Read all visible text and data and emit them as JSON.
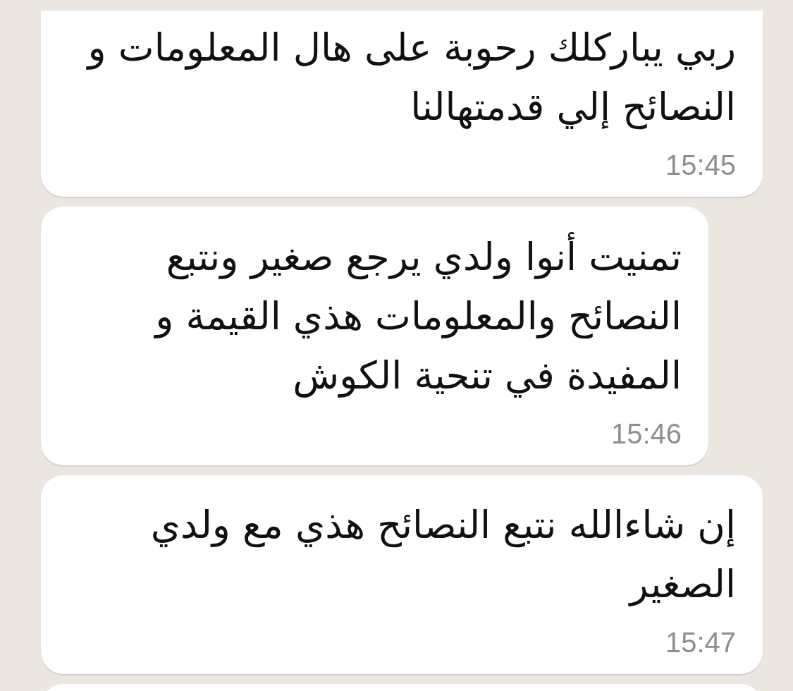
{
  "messages": [
    {
      "text": "ربي يباركلك رحوبة على هال المعلومات و النصائح إلي قدمتهالنا",
      "time": "15:45"
    },
    {
      "text": "تمنيت أنوا ولدي يرجع صغير ونتبع النصائح والمعلومات هذي القيمة و المفيدة في تنحية الكوش",
      "time": "15:46"
    },
    {
      "text": "إن شاءالله نتبع النصائح هذي مع ولدي الصغير",
      "time": "15:47"
    }
  ]
}
